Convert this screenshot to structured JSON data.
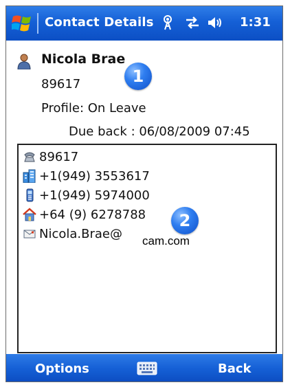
{
  "title_bar": {
    "title": "Contact Details",
    "time": "1:31",
    "icons": [
      "windows-start-icon",
      "signal-antenna-icon",
      "sync-arrows-icon",
      "speaker-icon"
    ]
  },
  "contact": {
    "name": "Nicola Brae",
    "id": "89617",
    "profile": "Profile: On Leave",
    "due_back": "Due back : 06/08/2009 07:45"
  },
  "callouts": [
    "1",
    "2"
  ],
  "details": [
    {
      "icon": "phone-handset-icon",
      "text": "89617"
    },
    {
      "icon": "office-building-icon",
      "text": "+1(949) 3553617"
    },
    {
      "icon": "mobile-phone-icon",
      "text": "+1(949) 5974000"
    },
    {
      "icon": "home-icon",
      "text": "+64 (9) 6278788"
    },
    {
      "icon": "email-envelope-icon",
      "text": "Nicola.Brae@",
      "text_suffix": "cam.com"
    }
  ],
  "soft_keys": {
    "left": "Options",
    "right": "Back",
    "center_icon": "keyboard-icon"
  },
  "colors": {
    "bar_blue": "#1560d6",
    "callout_blue": "#2f7ef0"
  }
}
